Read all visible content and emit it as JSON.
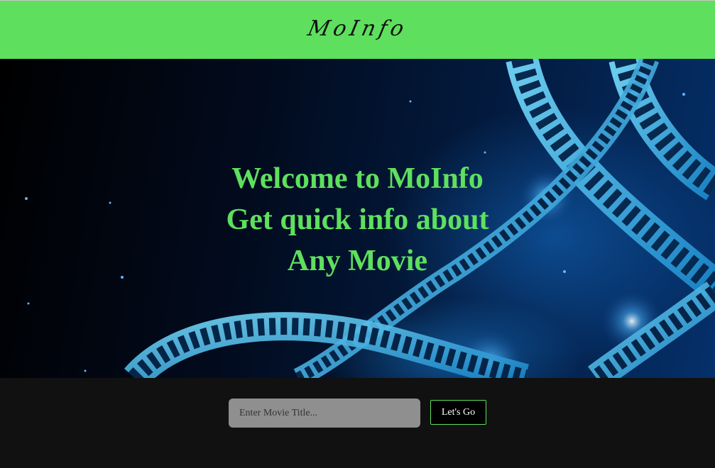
{
  "header": {
    "logo": "MoInfo",
    "background_color": "#5ee05e"
  },
  "hero": {
    "line1": "Welcome to MoInfo",
    "line2": "Get quick info about",
    "line3": "Any Movie",
    "text_color": "#5ee05e",
    "background_image": "film-reel-image"
  },
  "search": {
    "placeholder": "Enter Movie Title...",
    "value": "",
    "button_label": "Let's Go"
  }
}
